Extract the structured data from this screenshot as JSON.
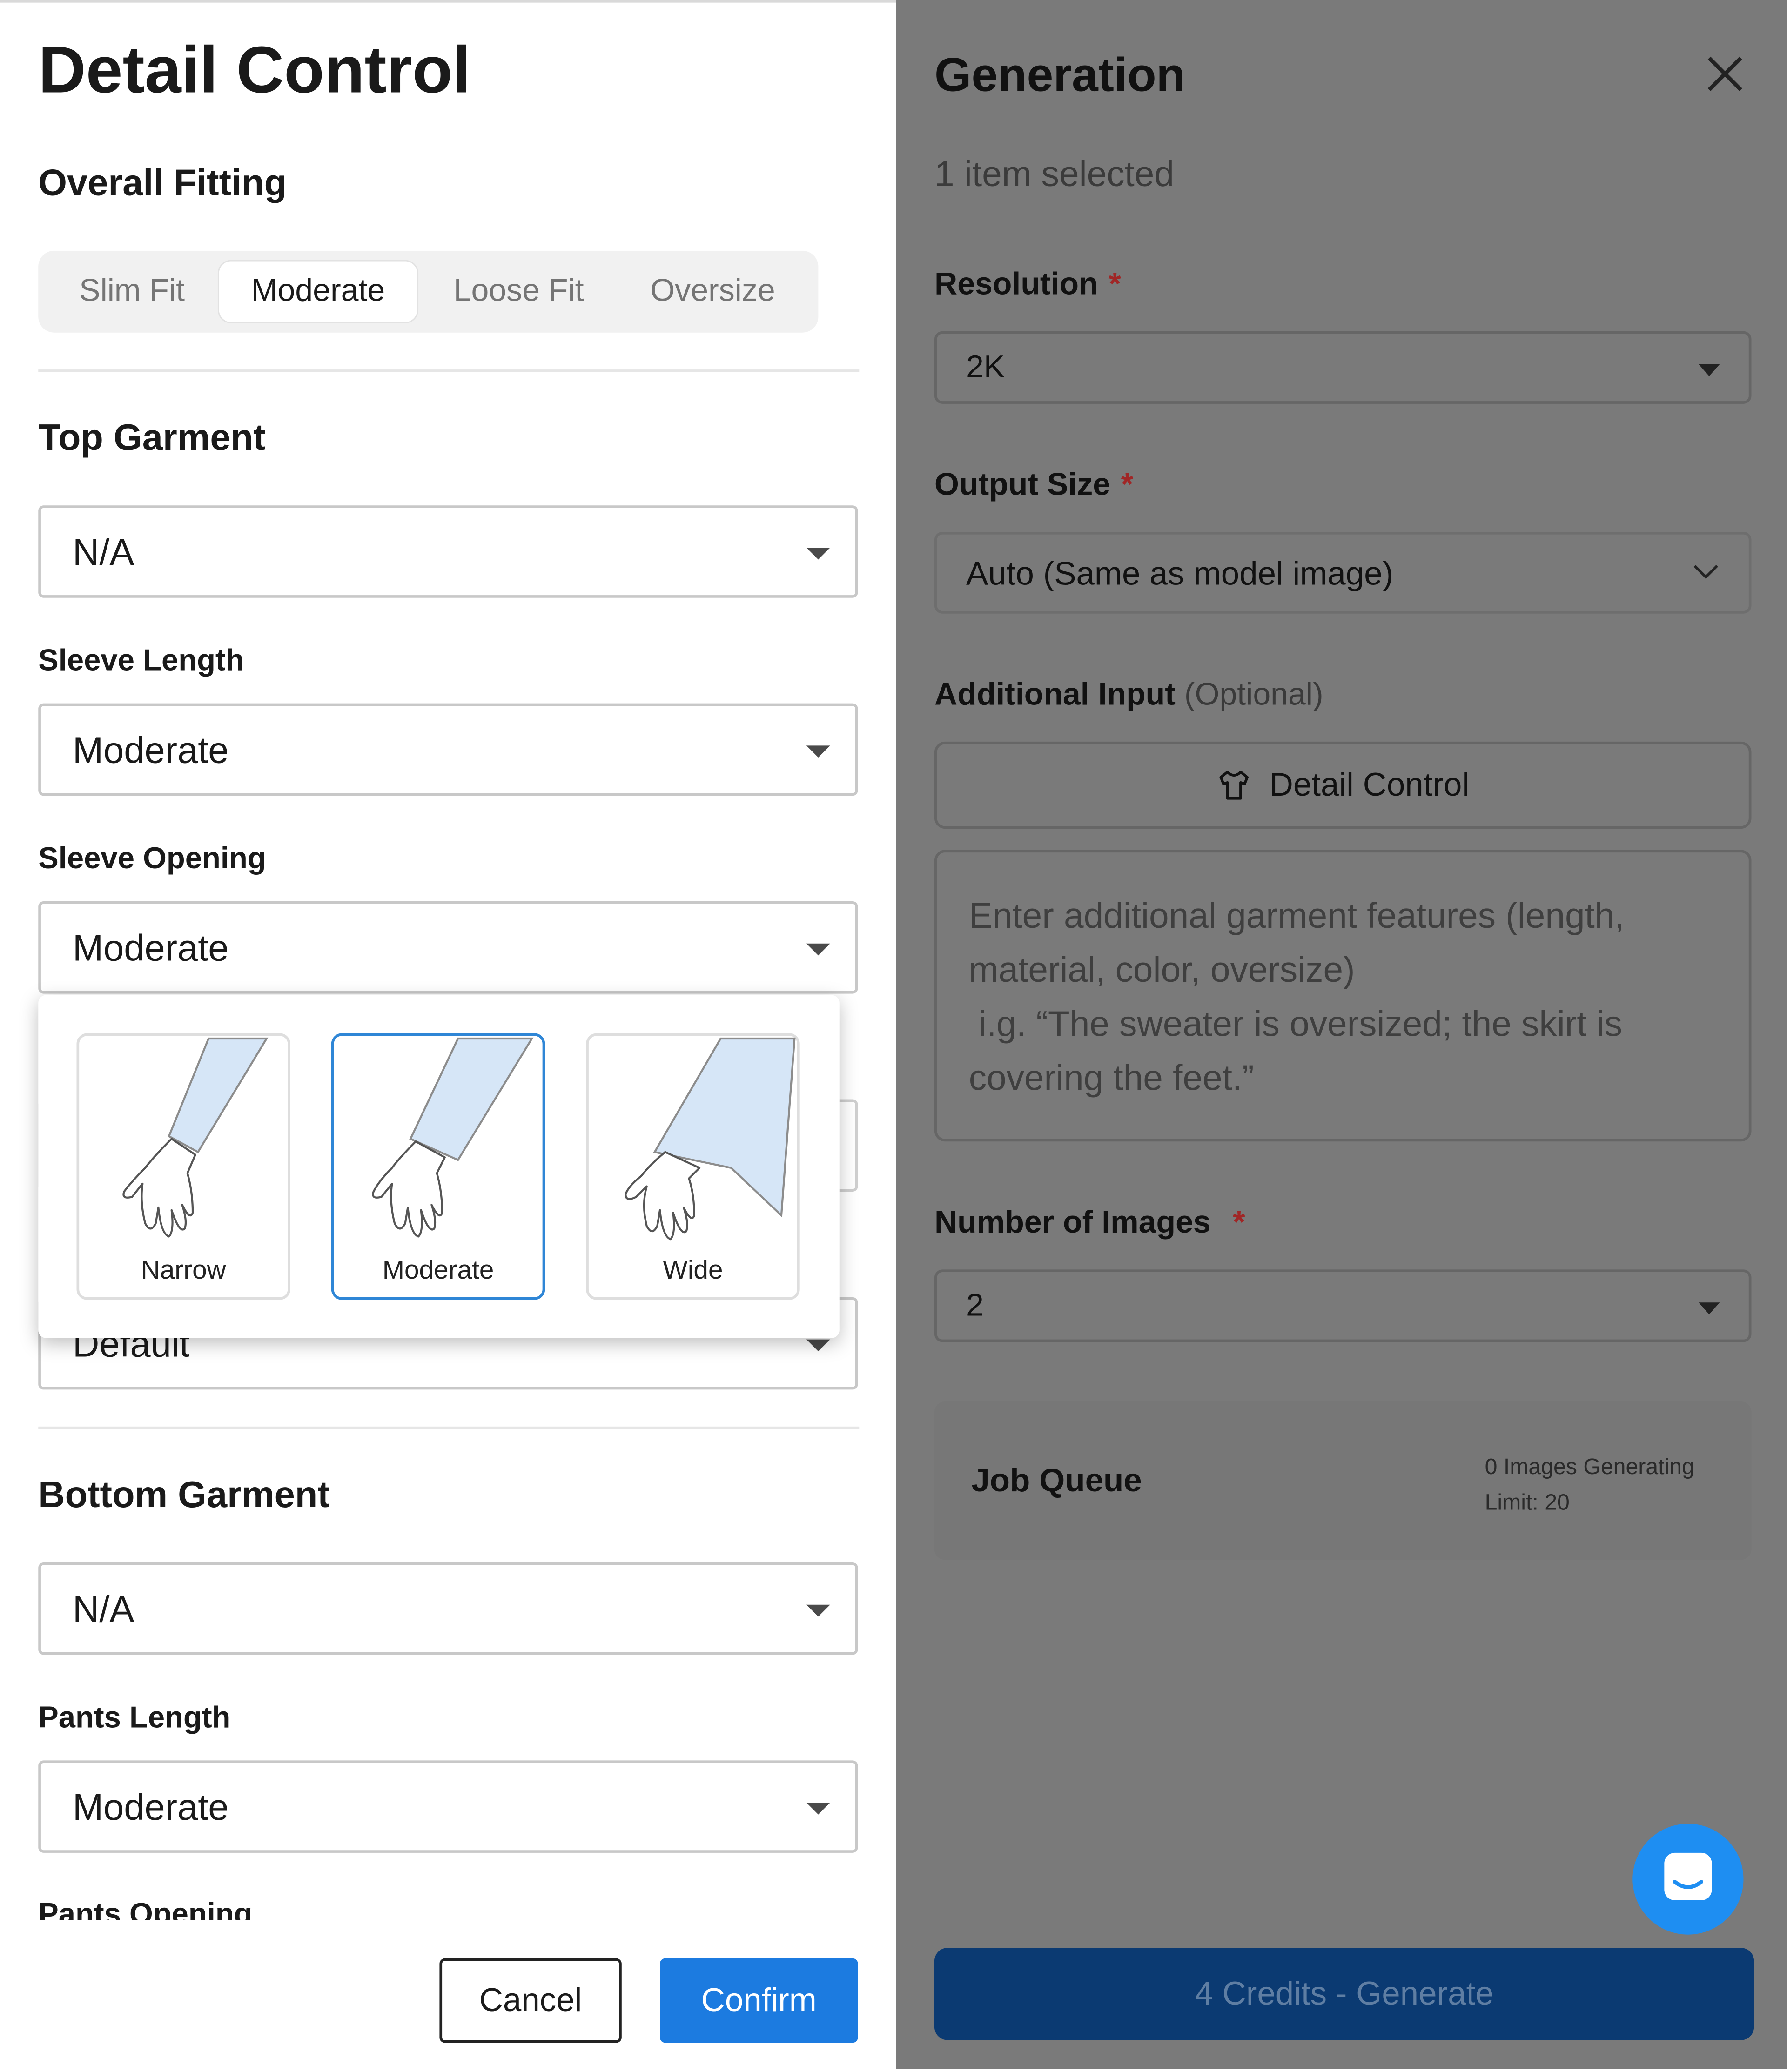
{
  "detail_control": {
    "title": "Detail Control",
    "overall_fitting": {
      "label": "Overall Fitting",
      "options": [
        "Slim Fit",
        "Moderate",
        "Loose Fit",
        "Oversize"
      ],
      "selected": "Moderate"
    },
    "top_garment": {
      "label": "Top Garment",
      "value": "N/A",
      "sleeve_length": {
        "label": "Sleeve Length",
        "value": "Moderate"
      },
      "sleeve_opening": {
        "label": "Sleeve Opening",
        "value": "Moderate",
        "options": [
          "Narrow",
          "Moderate",
          "Wide"
        ],
        "selected": "Moderate"
      },
      "hidden_field_value": "Default"
    },
    "bottom_garment": {
      "label": "Bottom Garment",
      "value": "N/A",
      "pants_length": {
        "label": "Pants Length",
        "value": "Moderate"
      },
      "pants_opening_label": "Pants Opening"
    },
    "cancel_label": "Cancel",
    "confirm_label": "Confirm"
  },
  "generation": {
    "title": "Generation",
    "selected_text": "1 item selected",
    "resolution": {
      "label": "Resolution",
      "required_mark": "*",
      "value": "2K"
    },
    "output_size": {
      "label": "Output Size",
      "required_mark": "*",
      "value": "Auto (Same as model image)"
    },
    "additional_input": {
      "label": "Additional Input",
      "optional_text": "(Optional)",
      "detail_control_button": "Detail Control",
      "placeholder": "Enter additional garment features (length, material, color, oversize)\n i.g. “The sweater is oversized; the skirt is covering the feet.”"
    },
    "number_of_images": {
      "label": "Number of Images",
      "required_mark": "*",
      "value": "2"
    },
    "job_queue": {
      "title": "Job Queue",
      "generating": "0 Images Generating",
      "limit": "Limit: 20"
    },
    "generate_button": "4 Credits - Generate"
  },
  "colors": {
    "accent": "#1c7be0",
    "overlay": "#7a7a7a",
    "required": "#a02626",
    "chat": "#1e8ef2",
    "generate": "#0b3a72",
    "selected_card": "#2f86d6"
  },
  "icons": [
    "close-icon",
    "shirt-icon",
    "caret-down-icon",
    "chevron-down-icon",
    "chat-icon",
    "sleeve-narrow-illustration",
    "sleeve-moderate-illustration",
    "sleeve-wide-illustration"
  ]
}
